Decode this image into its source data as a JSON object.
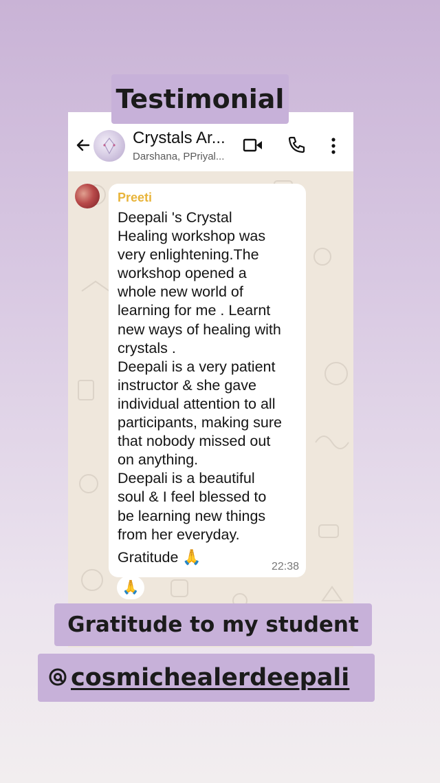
{
  "stickers": {
    "title": "Testimonial",
    "gratitude": "Gratitude to my student",
    "handle_prefix_icon": "threads-icon",
    "handle": "cosmichealerdeepali"
  },
  "chat": {
    "header": {
      "title": "Crystals Ar...",
      "subtitle": "Darshana, PPriyal..."
    },
    "message": {
      "sender": "Preeti",
      "lines": [
        "Deepali 's Crystal",
        "Healing workshop was",
        "very enlightening.The",
        "workshop opened a",
        "whole new world of",
        "learning for me . Learnt",
        "new ways of healing with",
        "crystals .",
        "Deepali is a very patient",
        "instructor & she gave",
        "individual attention to all",
        "participants, making sure",
        "that nobody missed out",
        "on anything.",
        "Deepali is a beautiful",
        "soul & I feel blessed to",
        "be learning new things",
        "from  her everyday."
      ],
      "last_line": "Gratitude",
      "last_line_emoji": "🙏",
      "time": "22:38",
      "reaction": "🙏"
    }
  },
  "colors": {
    "sticker_bg": "#c7b1d9",
    "sender_name": "#e8b43a",
    "chat_bg": "#efe7dc"
  }
}
